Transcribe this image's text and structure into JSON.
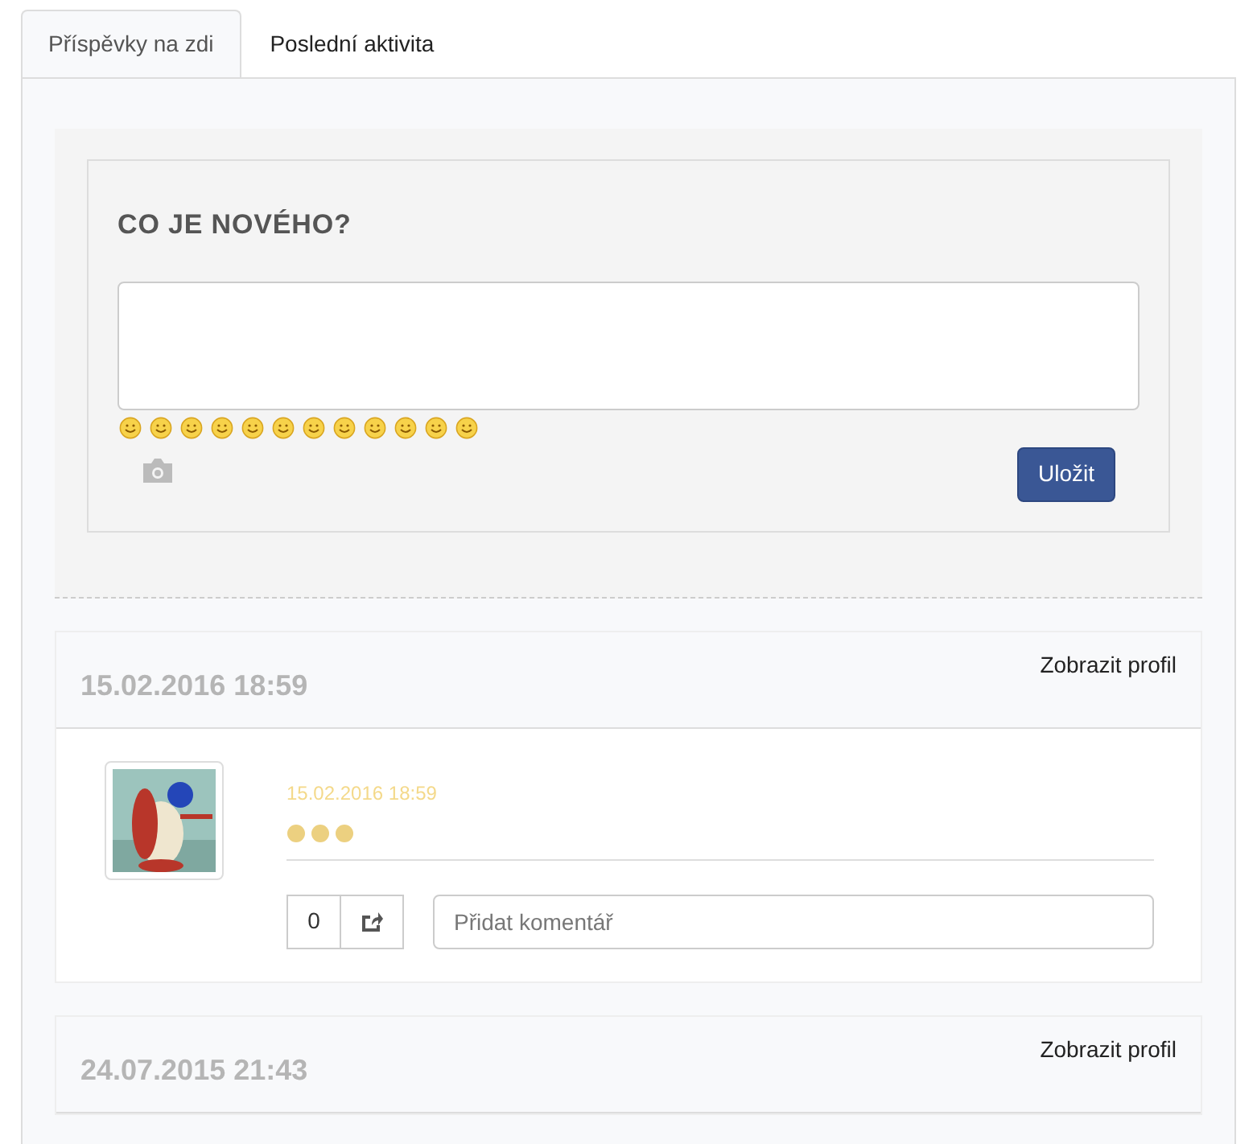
{
  "tabs": [
    {
      "label": "Příspěvky na zdi",
      "selected": true
    },
    {
      "label": "Poslední aktivita",
      "selected": false
    }
  ],
  "composer": {
    "title": "CO JE NOVÉHO?",
    "save_button": "Uložit"
  },
  "posts": [
    {
      "date": "15.02.2016 18:59",
      "profile_link": "Zobrazit profil",
      "author_date": "15.02.2016 18:59",
      "likes": "0",
      "comment_placeholder": "Přidat komentář"
    },
    {
      "date": "24.07.2015 21:43",
      "profile_link": "Zobrazit profil"
    }
  ]
}
